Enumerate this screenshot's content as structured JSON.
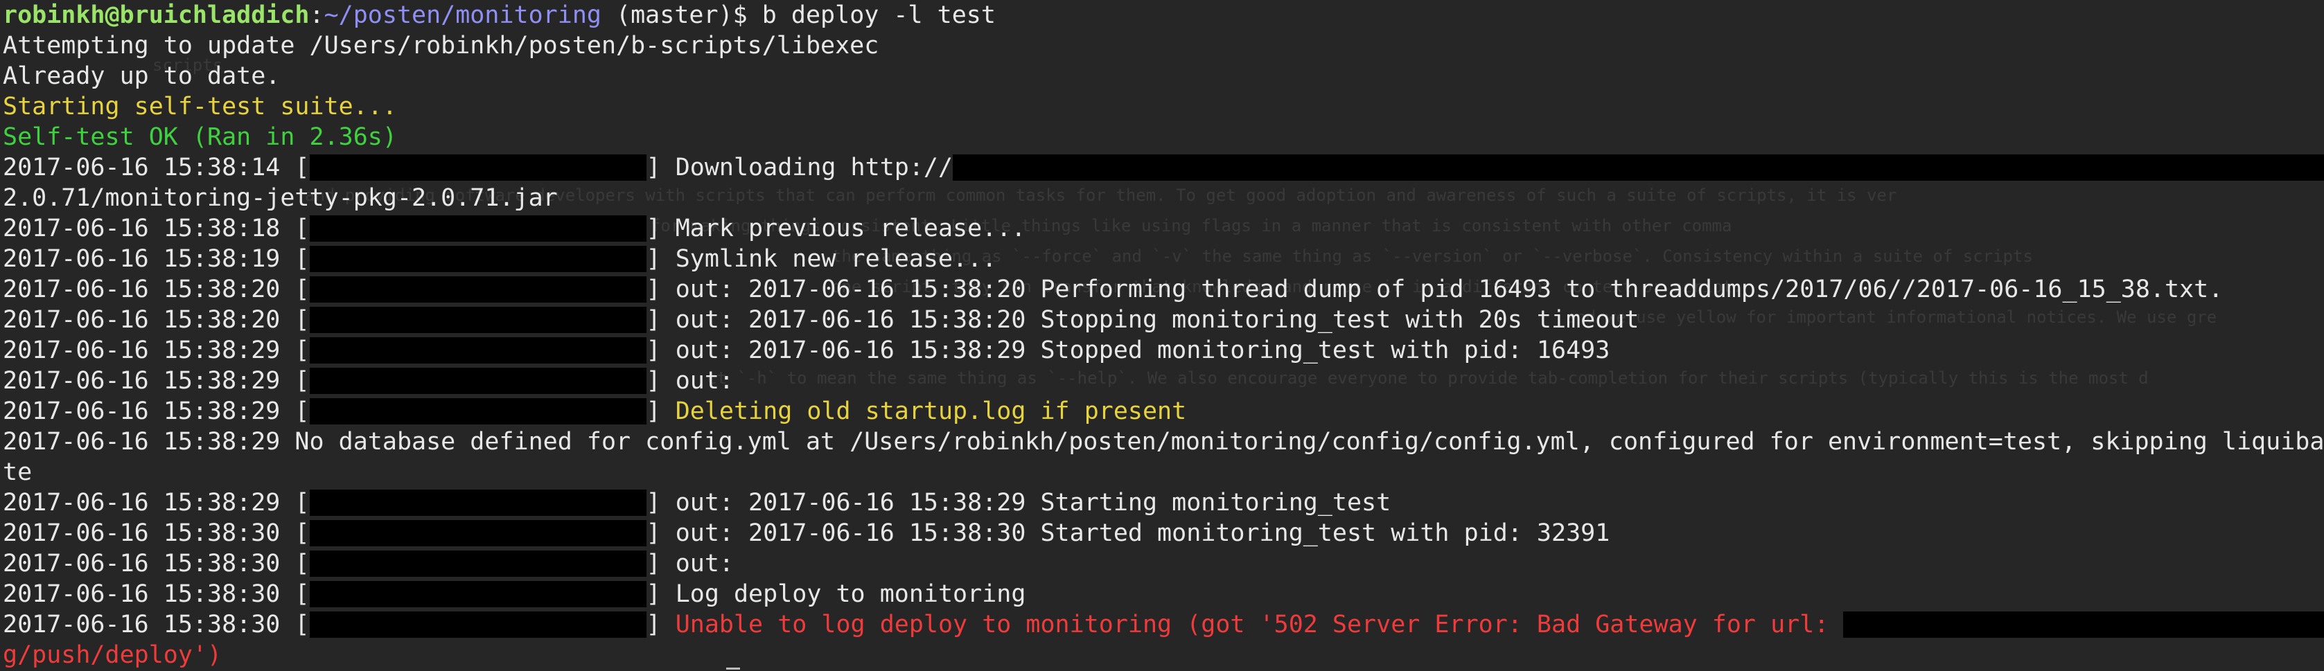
{
  "prompt": {
    "user_host": "robinkh@bruichladdich",
    "path": "~/posten/monitoring",
    "rest": " (master)$ b deploy -l test"
  },
  "output": {
    "attempt": "Attempting to update /Users/robinkh/posten/b-scripts/libexec",
    "uptodate": "Already up to date.",
    "selftest_start": "Starting self-test suite...",
    "selftest_ok": "Self-test OK (Ran in 2.36s)"
  },
  "log": [
    {
      "ts": "2017-06-16 15:38:14",
      "msg": "Downloading http://"
    },
    {
      "ts": "2017-06-16 15:38:18",
      "msg": "Mark previous release..."
    },
    {
      "ts": "2017-06-16 15:38:19",
      "msg": "Symlink new release..."
    },
    {
      "ts": "2017-06-16 15:38:20",
      "msg": "out: 2017-06-16 15:38:20 Performing thread dump of pid 16493 to threaddumps/2017/06//2017-06-16_15_38.txt."
    },
    {
      "ts": "2017-06-16 15:38:20",
      "msg": "out: 2017-06-16 15:38:20 Stopping monitoring_test with 20s timeout"
    },
    {
      "ts": "2017-06-16 15:38:29",
      "msg": "out: 2017-06-16 15:38:29 Stopped monitoring_test with pid: 16493"
    },
    {
      "ts": "2017-06-16 15:38:29",
      "msg": "out:"
    },
    {
      "ts": "2017-06-16 15:38:29",
      "msg": "Deleting old startup.log if present"
    },
    {
      "ts": "2017-06-16 15:38:29",
      "msg": "out: 2017-06-16 15:38:29 Starting monitoring_test"
    },
    {
      "ts": "2017-06-16 15:38:30",
      "msg": "out: 2017-06-16 15:38:30 Started monitoring_test with pid: 32391"
    },
    {
      "ts": "2017-06-16 15:38:30",
      "msg": "out:"
    },
    {
      "ts": "2017-06-16 15:38:30",
      "msg": "Log deploy to monitoring"
    },
    {
      "ts": "2017-06-16 15:38:30",
      "msg": "Unable to log deploy to monitoring (got '502 Server Error: Bad Gateway for url: "
    }
  ],
  "download_cont": "2.0.71/monitoring-jetty-pkg-2.0.71.jar",
  "no_db": {
    "line1": "2017-06-16 15:38:29 No database defined for config.yml at /Users/robinkh/posten/monitoring/config/config.yml, configured for environment=test, skipping liquibase migra",
    "line2": "te"
  },
  "error_cont": "g/push/deploy')",
  "colors": {
    "background": "#262626",
    "text": "#e8e8e8",
    "prompt_user": "#9be46a",
    "prompt_path": "#8f8ff5",
    "yellow": "#e6d33f",
    "green": "#3fd13f",
    "red": "#ef3b3b",
    "redaction": "#000000"
  }
}
